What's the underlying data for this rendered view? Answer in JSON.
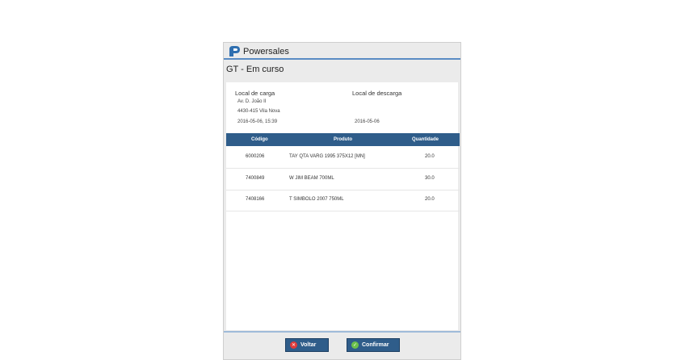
{
  "app": {
    "title": "Powersales"
  },
  "screen": {
    "title": "GT - Em curso"
  },
  "loading": {
    "label": "Local de carga",
    "address_line1": "Av. D. João II",
    "address_line2": "4430-415 Vila Nova",
    "datetime": "2016-05-06, 15:39"
  },
  "unloading": {
    "label": "Local de descarga",
    "date": "2016-05-06"
  },
  "table": {
    "headers": {
      "code": "Código",
      "product": "Produto",
      "quantity": "Quantidade"
    },
    "rows": [
      {
        "code": "6000206",
        "product": "TAY QTA VARG 1995 375X12 [MN]",
        "quantity": "20.0"
      },
      {
        "code": "7400849",
        "product": "W JIM BEAM 700ML",
        "quantity": "30.0"
      },
      {
        "code": "7408166",
        "product": "T SIMBOLO  2007 750ML",
        "quantity": "20.0"
      }
    ]
  },
  "buttons": {
    "back": "Voltar",
    "confirm": "Confirmar"
  },
  "colors": {
    "header_blue": "#2f5d8a",
    "accent_blue": "#5a8cc4",
    "back_icon": "#e03a3a",
    "confirm_icon": "#6cc04a"
  }
}
